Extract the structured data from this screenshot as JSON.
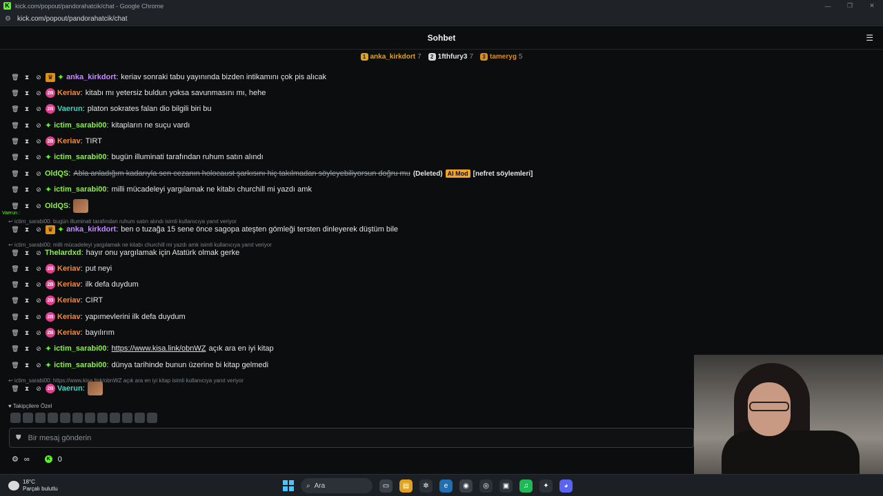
{
  "window": {
    "title": "kick.com/popout/pandorahatcik/chat - Google Chrome",
    "url": "kick.com/popout/pandorahatcik/chat",
    "favicon": "K"
  },
  "header": {
    "title": "Sohbet",
    "icon": "users-icon"
  },
  "leaderboard": [
    {
      "medal": "1",
      "name": "anka_kirkdort",
      "count": "7",
      "color": "#e0a31f",
      "name_color": "#e0a31f"
    },
    {
      "medal": "2",
      "name": "1fthfury3",
      "count": "7",
      "color": "#d9d9d9",
      "name_color": "#e6e6e6"
    },
    {
      "medal": "3",
      "name": "tameryg",
      "count": "5",
      "color": "#d9901c",
      "name_color": "#d9901c"
    }
  ],
  "messages": [
    {
      "user": "anka_kirkdort",
      "color": "#c58bff",
      "badge": "crown+gift",
      "text": "keriav sonraki tabu yayınında bizden intikamını çok pis alıcak"
    },
    {
      "user": "Keriav",
      "color": "#f28b43",
      "badge": "sub",
      "sub": "2B",
      "text": "kitabı mı yetersiz buldun yoksa savunmasını mı, hehe"
    },
    {
      "user": "Vaerun",
      "color": "#3fd6c6",
      "badge": "sub",
      "sub": "2B",
      "text": "platon sokrates falan dio bilgili biri bu"
    },
    {
      "user": "ictim_sarabi00",
      "color": "#8bf04a",
      "badge": "gift",
      "text": "kitapların ne suçu vardı"
    },
    {
      "user": "Keriav",
      "color": "#f28b43",
      "badge": "sub",
      "sub": "2B",
      "text": "TIRT"
    },
    {
      "user": "ictim_sarabi00",
      "color": "#8bf04a",
      "badge": "gift",
      "text": "bugün illuminati tarafından ruhum satın alındı"
    },
    {
      "user": "OldQS",
      "color": "#8bf04a",
      "badge": "none",
      "text": "Abla anladığım kadarıyla sen cezanın holocaust şarkısını hiç takılmadan söyleyebiliyorsun doğru mu",
      "deleted": "(Deleted)",
      "aimod": "AI Mod",
      "reason": "[nefret söylemleri]"
    },
    {
      "user": "ictim_sarabi00",
      "color": "#8bf04a",
      "badge": "gift",
      "text": "milli mücadeleyi yargılamak ne kitabı churchill mi yazdı amk"
    },
    {
      "user": "OldQS",
      "color": "#8bf04a",
      "badge": "none",
      "text": "",
      "emote": "face-emote"
    },
    {
      "reply": "ictim_sarabi00: bugün illuminati tarafından ruhum satın alındı isimli kullanıcıya yanıt veriyor"
    },
    {
      "user": "anka_kirkdort",
      "color": "#c58bff",
      "badge": "crown+gift",
      "text": "ben o tuzağa 15 sene önce sagopa ateşten gömleği tersten dinleyerek düştüm bile"
    },
    {
      "reply": "ictim_sarabi00: milli mücadeleyi yargılamak ne kitabı churchill mi yazdı amk isimli kullanıcıya yanıt veriyor"
    },
    {
      "user": "Thelardxd",
      "color": "#8bf04a",
      "badge": "none",
      "text": "hayır onu yargılamak için Atatürk olmak gerke"
    },
    {
      "user": "Keriav",
      "color": "#f28b43",
      "badge": "sub",
      "sub": "2B",
      "text": "put neyi"
    },
    {
      "user": "Keriav",
      "color": "#f28b43",
      "badge": "sub",
      "sub": "2B",
      "text": "ilk defa duydum"
    },
    {
      "user": "Keriav",
      "color": "#f28b43",
      "badge": "sub",
      "sub": "2B",
      "text": "CIRT"
    },
    {
      "user": "Keriav",
      "color": "#f28b43",
      "badge": "sub",
      "sub": "2B",
      "text": "yapımevlerini ilk defa duydum"
    },
    {
      "user": "Keriav",
      "color": "#f28b43",
      "badge": "sub",
      "sub": "2B",
      "text": "bayılırım"
    },
    {
      "user": "ictim_sarabi00",
      "color": "#8bf04a",
      "badge": "gift",
      "text": "açık ara en iyi kitap",
      "link": "https://www.kisa.link/obnWZ"
    },
    {
      "user": "ictim_sarabi00",
      "color": "#8bf04a",
      "badge": "gift",
      "text": "dünya tarihinde bunun üzerine bi kitap gelmedi"
    },
    {
      "reply": "ictim_sarabi00: https://www.kisa.link/obnWZ açık ara en iyi kitap isimli kullanıcıya yanıt veriyor"
    },
    {
      "user": "Vaerun",
      "color": "#3fd6c6",
      "badge": "sub",
      "sub": "2B",
      "text": "",
      "emote": "hand-emote"
    }
  ],
  "vaerun_tag": "Vaerun :",
  "followers_label": "Takipçilere Özel",
  "input": {
    "placeholder": "Bir mesaj gönderin"
  },
  "bottom": {
    "points": "0"
  },
  "taskbar": {
    "temp": "18°C",
    "weather": "Parçalı bulutlu",
    "search": "Ara"
  }
}
